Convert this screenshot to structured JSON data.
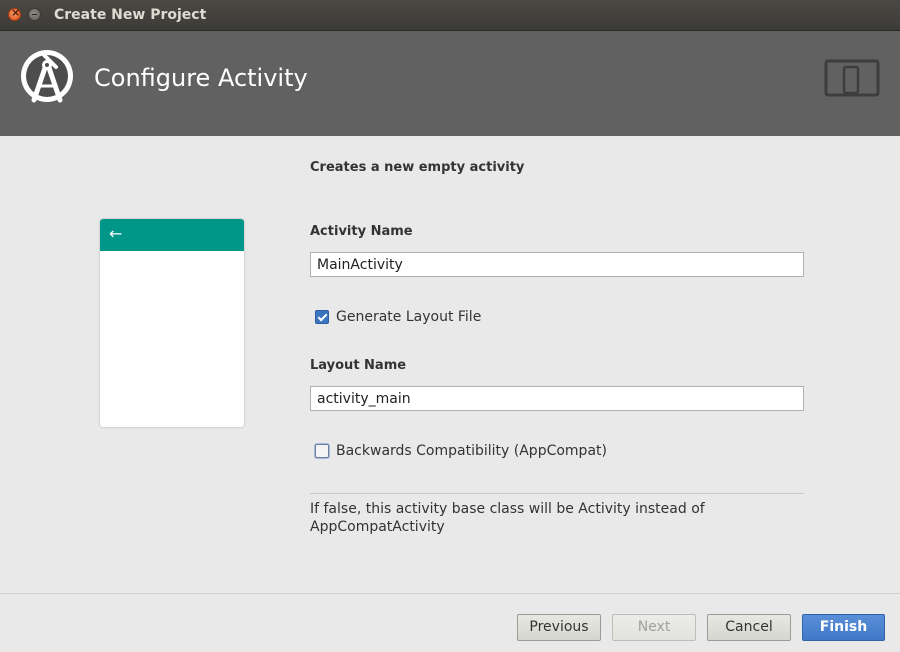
{
  "window": {
    "title": "Create New Project",
    "controls": {
      "close_icon": "close-icon",
      "minimize_icon": "minimize-icon"
    }
  },
  "header": {
    "title": "Configure Activity",
    "logo_icon": "android-studio-logo-icon",
    "device_icon": "tablet-phone-icon",
    "background": "#616161"
  },
  "preview": {
    "back_glyph": "←",
    "toolbar_color": "#009688"
  },
  "form": {
    "description": "Creates a new empty activity",
    "activity_name": {
      "label": "Activity Name",
      "value": "MainActivity"
    },
    "generate_layout": {
      "label": "Generate Layout File",
      "checked": true
    },
    "layout_name": {
      "label": "Layout Name",
      "value": "activity_main"
    },
    "backwards_compat": {
      "label": "Backwards Compatibility (AppCompat)",
      "checked": false
    },
    "info": "If false, this activity base class will be Activity instead of AppCompatActivity"
  },
  "buttons": {
    "previous": "Previous",
    "next": "Next",
    "cancel": "Cancel",
    "finish": "Finish"
  },
  "colors": {
    "accent": "#4a83cf",
    "checkbox_checked": "#3b74c0"
  }
}
